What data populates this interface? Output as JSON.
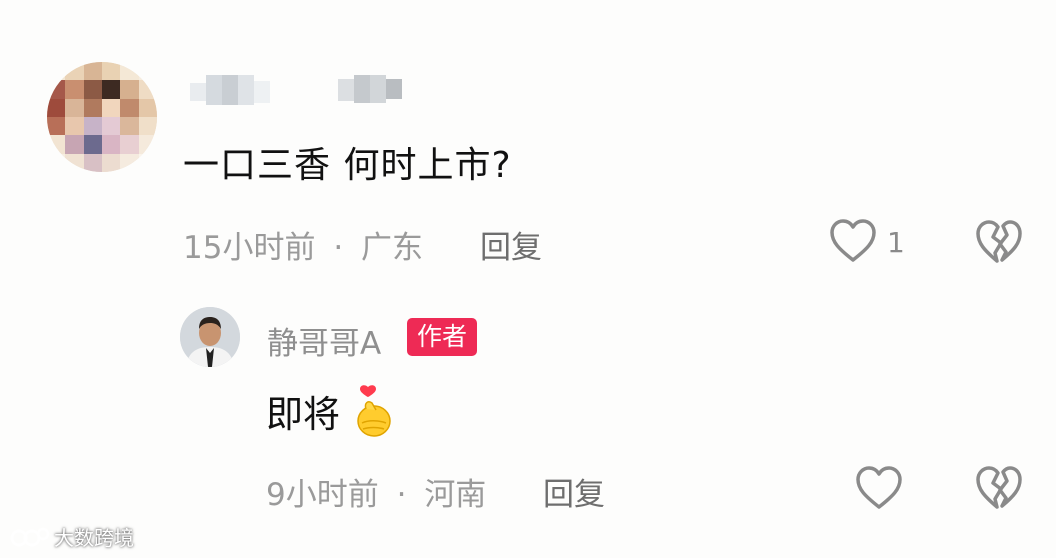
{
  "comment": {
    "text": "一口三香  何时上市?",
    "time": "15小时前",
    "separator": "·",
    "location": "广东",
    "reply_label": "回复",
    "like_count": "1",
    "like_icon": "heart-outline-icon",
    "dislike_icon": "broken-heart-icon"
  },
  "reply": {
    "username": "静哥哥A",
    "badge": "作者",
    "text": "即将",
    "emoji": "finger-heart-emoji",
    "time": "9小时前",
    "separator": "·",
    "location": "河南",
    "reply_label": "回复",
    "like_icon": "heart-outline-icon",
    "dislike_icon": "broken-heart-icon"
  },
  "watermark": {
    "text": "大数跨境"
  },
  "colors": {
    "badge": "#ee2a55",
    "meta": "#9a9a9a",
    "text": "#111111"
  }
}
